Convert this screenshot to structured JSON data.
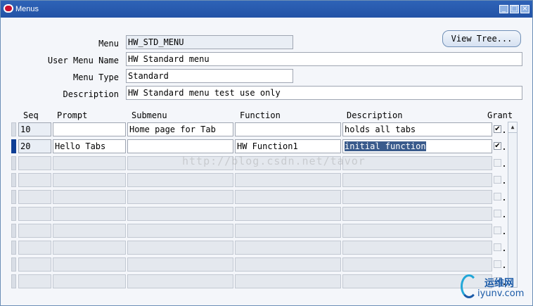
{
  "window": {
    "title": "Menus",
    "controls": [
      "_",
      "□",
      "×"
    ]
  },
  "header": {
    "menu_label": "Menu",
    "menu_value": "HW_STD_MENU",
    "user_menu_name_label": "User Menu Name",
    "user_menu_name_value": "HW Standard menu",
    "menu_type_label": "Menu Type",
    "menu_type_value": "Standard",
    "description_label": "Description",
    "description_value": "HW Standard menu test use only",
    "view_tree_label": "View Tree..."
  },
  "grid": {
    "columns": {
      "seq": "Seq",
      "prompt": "Prompt",
      "submenu": "Submenu",
      "function": "Function",
      "description": "Description",
      "grant": "Grant"
    },
    "rows": [
      {
        "seq": "10",
        "prompt": "",
        "submenu": "Home page for Tab",
        "function": "",
        "description": "holds all tabs",
        "grant": "✔"
      },
      {
        "seq": "20",
        "prompt": "Hello Tabs",
        "submenu": "",
        "function": "HW Function1",
        "description": "initial function",
        "grant": "✔"
      }
    ]
  },
  "watermark": "http://blog.csdn.net/tavor",
  "logo": {
    "cn": "运维网",
    "en": "iyunv.com"
  }
}
